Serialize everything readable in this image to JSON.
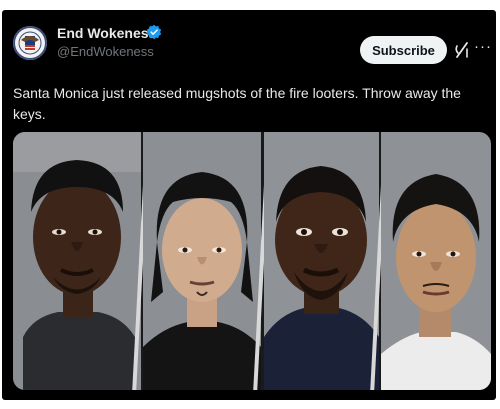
{
  "account": {
    "display_name": "End Wokeness",
    "handle": "@EndWokeness",
    "verified_badge_icon": "verified-badge-icon",
    "avatar_icon": "eagle-seal-avatar"
  },
  "actions": {
    "subscribe_label": "Subscribe",
    "grok_icon": "grok-icon",
    "more_icon": "more-options-icon",
    "more_glyph": "···"
  },
  "tweet": {
    "text": "Santa Monica just released mugshots of the fire looters. Throw away the keys."
  },
  "media": {
    "description_type": "photo-collage",
    "panel_count": 4
  },
  "colors": {
    "background": "#000000",
    "primary_text": "#e7e9ea",
    "secondary_text": "#71767b",
    "verified_blue": "#1d9bf0",
    "button_bg": "#eff3f4"
  }
}
